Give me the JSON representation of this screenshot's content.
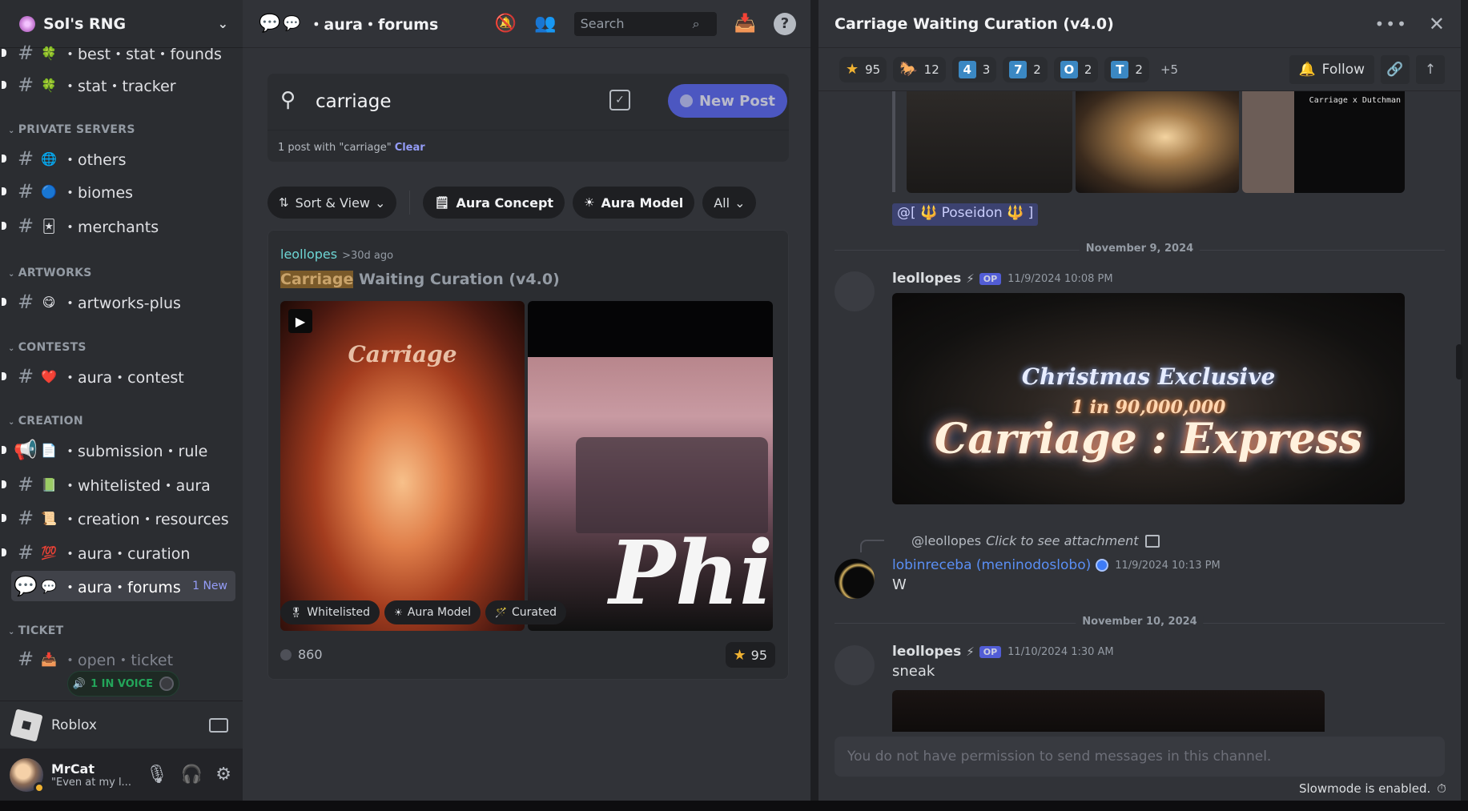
{
  "server": {
    "name": "Sol's RNG"
  },
  "sidebar": {
    "channels": [
      {
        "emoji": "🍀",
        "label": "・best・stat・founds"
      },
      {
        "emoji": "🍀",
        "label": "・stat・tracker"
      },
      {
        "category": "PRIVATE SERVERS"
      },
      {
        "emoji": "🌐",
        "label": "・others"
      },
      {
        "emoji": "🔵",
        "label": "・biomes"
      },
      {
        "emoji": "🃏",
        "label": "・merchants"
      },
      {
        "category": "ARTWORKS"
      },
      {
        "emoji": "😋",
        "label": "・artworks-plus"
      },
      {
        "category": "CONTESTS"
      },
      {
        "emoji": "❤️",
        "label": "・aura・contest"
      },
      {
        "category": "CREATION"
      },
      {
        "emoji": "📄",
        "label": "・submission・rule"
      },
      {
        "emoji": "📗",
        "label": "・whitelisted・aura"
      },
      {
        "emoji": "📜",
        "label": "・creation・resources"
      },
      {
        "emoji": "💯",
        "label": "・aura・curation"
      },
      {
        "emoji": "💬",
        "label": "・aura・forums",
        "badge": "1 New"
      },
      {
        "category": "TICKET"
      },
      {
        "emoji": "📥",
        "label": "・open・ticket"
      }
    ],
    "voice_pill": "1 IN VOICE",
    "activity": "Roblox",
    "user": {
      "name": "MrCat",
      "status": "\"Even at my l..."
    }
  },
  "forum": {
    "channel": "・aura・forums",
    "search_placeholder": "Search",
    "query": "carriage",
    "new_post": "New Post",
    "result_count": "1 post with \"carriage\"",
    "clear": "Clear",
    "filters": {
      "sort": "Sort & View",
      "tag1": "Aura Concept",
      "tag2": "Aura Model",
      "all": "All"
    },
    "post": {
      "author": "leollopes",
      "ago": ">30d ago",
      "title_highlight": "Carriage",
      "title_rest": " Waiting Curation (v4.0)",
      "media1_overlay": "Carriage",
      "media2_overlay": "Phi",
      "tags": [
        "Whitelisted",
        "Aura Model",
        "Curated"
      ],
      "messages": "860",
      "star_count": "95"
    }
  },
  "thread": {
    "title": "Carriage Waiting Curation (v4.0)",
    "reactions": [
      {
        "emoji": "⭐",
        "count": "95"
      },
      {
        "emoji": "🐎",
        "count": "12"
      },
      {
        "key": "4",
        "count": "3"
      },
      {
        "key": "7",
        "count": "2"
      },
      {
        "key": "O",
        "count": "2"
      },
      {
        "key": "T",
        "count": "2"
      }
    ],
    "more": "+5",
    "follow": "Follow",
    "prev_media_text": "Carriage x Dutchman",
    "mention": "@[ 🔱 Poseidon 🔱 ]",
    "date1": "November 9, 2024",
    "msg1": {
      "author": "leollopes",
      "op": "OP",
      "time": "11/9/2024 10:08 PM"
    },
    "media": {
      "line1": "Christmas Exclusive",
      "line2": "1 in 90,000,000",
      "line3": "Carriage : Express"
    },
    "reply": {
      "who": "@leollopes",
      "what": "Click to see attachment"
    },
    "msg2": {
      "author": "lobinreceba (meninodoslobo)",
      "time": "11/9/2024 10:13 PM",
      "text": "W"
    },
    "date2": "November 10, 2024",
    "msg3": {
      "author": "leollopes",
      "op": "OP",
      "time": "11/10/2024 1:30 AM",
      "text": "sneak"
    },
    "composer": "You do not have permission to send messages in this channel.",
    "slowmode": "Slowmode is enabled."
  }
}
